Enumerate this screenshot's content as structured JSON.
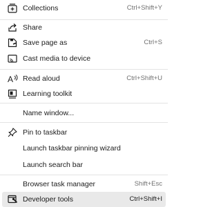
{
  "menu": {
    "items": [
      {
        "label": "Collections",
        "shortcut": "Ctrl+Shift+Y",
        "icon": "collections-icon"
      },
      {
        "label": "Share",
        "shortcut": "",
        "icon": "share-icon"
      },
      {
        "label": "Save page as",
        "shortcut": "Ctrl+S",
        "icon": "save-page-icon"
      },
      {
        "label": "Cast media to device",
        "shortcut": "",
        "icon": "cast-icon"
      },
      {
        "label": "Read aloud",
        "shortcut": "Ctrl+Shift+U",
        "icon": "read-aloud-icon"
      },
      {
        "label": "Learning toolkit",
        "shortcut": "",
        "icon": "learning-toolkit-icon"
      },
      {
        "label": "Name window...",
        "shortcut": ""
      },
      {
        "label": "Pin to taskbar",
        "shortcut": "",
        "icon": "pin-icon"
      },
      {
        "label": "Launch taskbar pinning wizard",
        "shortcut": ""
      },
      {
        "label": "Launch search bar",
        "shortcut": ""
      },
      {
        "label": "Browser task manager",
        "shortcut": "Shift+Esc"
      },
      {
        "label": "Developer tools",
        "shortcut": "Ctrl+Shift+I",
        "icon": "developer-tools-icon"
      }
    ],
    "highlighted_item": "Developer tools"
  },
  "colors": {
    "hover_background": "#e9e9e9",
    "separator": "#e3e3e3",
    "shortcut_text": "#707070",
    "text": "#1b1b1b"
  }
}
